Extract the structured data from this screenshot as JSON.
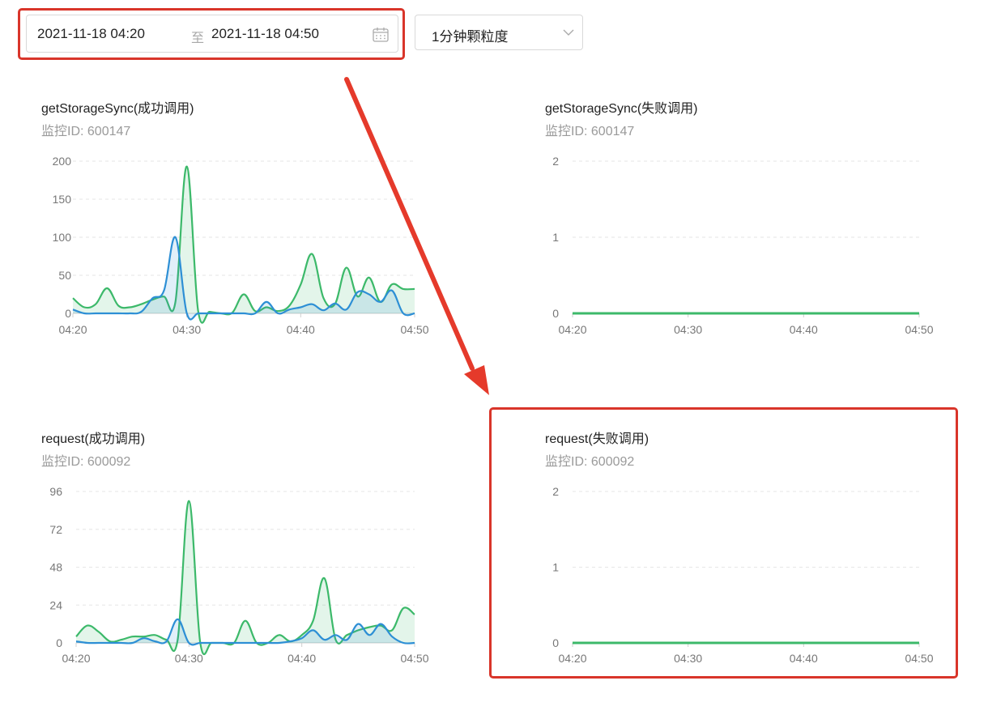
{
  "toolbar": {
    "start": "2021-11-18 04:20",
    "separator": "至",
    "end": "2021-11-18 04:50",
    "granularity": "1分钟颗粒度"
  },
  "colors": {
    "green": "#3cb96a",
    "blue": "#2d8fd5",
    "highlight": "#d9352a"
  },
  "chart_data": [
    {
      "type": "area",
      "title": "getStorageSync(成功调用)",
      "subtitle": "监控ID: 600147",
      "xlabel": "",
      "ylabel": "",
      "x_ticks": [
        "04:20",
        "04:30",
        "04:40",
        "04:50"
      ],
      "y_ticks": [
        0,
        50,
        100,
        150,
        200
      ],
      "ylim": [
        0,
        200
      ],
      "grid": true,
      "series": [
        {
          "color": "#3cb96a",
          "x": [
            0,
            1,
            2,
            3,
            4,
            5,
            6,
            7,
            8,
            9,
            10,
            11,
            12,
            13,
            14,
            15,
            16,
            17,
            18,
            19,
            20,
            21,
            22,
            23,
            24,
            25,
            26,
            27,
            28,
            29,
            30
          ],
          "values": [
            20,
            8,
            12,
            33,
            10,
            8,
            12,
            18,
            22,
            15,
            193,
            3,
            2,
            0,
            1,
            25,
            3,
            8,
            3,
            10,
            38,
            78,
            20,
            12,
            60,
            22,
            47,
            15,
            38,
            32,
            32
          ]
        },
        {
          "color": "#2d8fd5",
          "x": [
            0,
            1,
            2,
            3,
            4,
            5,
            6,
            7,
            8,
            9,
            10,
            11,
            12,
            13,
            14,
            15,
            16,
            17,
            18,
            19,
            20,
            21,
            22,
            23,
            24,
            25,
            26,
            27,
            28,
            29,
            30
          ],
          "values": [
            5,
            0,
            0,
            0,
            0,
            0,
            2,
            20,
            30,
            100,
            0,
            0,
            0,
            0,
            0,
            0,
            0,
            15,
            0,
            5,
            8,
            12,
            4,
            13,
            5,
            28,
            25,
            15,
            30,
            0,
            0
          ]
        }
      ]
    },
    {
      "type": "line",
      "title": "getStorageSync(失败调用)",
      "subtitle": "监控ID: 600147",
      "xlabel": "",
      "ylabel": "",
      "x_ticks": [
        "04:20",
        "04:30",
        "04:40",
        "04:50"
      ],
      "y_ticks": [
        0,
        1,
        2
      ],
      "ylim": [
        0,
        2
      ],
      "grid": true,
      "series": [
        {
          "color": "#3cb96a",
          "x": [
            0,
            30
          ],
          "values": [
            0,
            0
          ]
        }
      ]
    },
    {
      "type": "area",
      "title": "request(成功调用)",
      "subtitle": "监控ID: 600092",
      "xlabel": "",
      "ylabel": "",
      "x_ticks": [
        "04:20",
        "04:30",
        "04:40",
        "04:50"
      ],
      "y_ticks": [
        0,
        24,
        48,
        72,
        96
      ],
      "ylim": [
        0,
        96
      ],
      "grid": true,
      "series": [
        {
          "color": "#3cb96a",
          "x": [
            0,
            1,
            2,
            3,
            4,
            5,
            6,
            7,
            8,
            9,
            10,
            11,
            12,
            13,
            14,
            15,
            16,
            17,
            18,
            19,
            20,
            21,
            22,
            23,
            24,
            25,
            26,
            27,
            28,
            29,
            30
          ],
          "values": [
            4,
            11,
            7,
            1,
            2,
            4,
            4,
            5,
            2,
            2,
            90,
            0,
            0,
            0,
            0,
            14,
            0,
            0,
            5,
            1,
            5,
            14,
            41,
            2,
            5,
            8,
            10,
            11,
            8,
            22,
            18
          ]
        },
        {
          "color": "#2d8fd5",
          "x": [
            0,
            1,
            2,
            3,
            4,
            5,
            6,
            7,
            8,
            9,
            10,
            11,
            12,
            13,
            14,
            15,
            16,
            17,
            18,
            19,
            20,
            21,
            22,
            23,
            24,
            25,
            26,
            27,
            28,
            29,
            30
          ],
          "values": [
            1,
            0,
            0,
            0,
            0,
            0,
            3,
            1,
            1,
            15,
            0,
            0,
            0,
            0,
            0,
            0,
            0,
            0,
            0,
            1,
            3,
            8,
            2,
            5,
            2,
            12,
            5,
            12,
            4,
            0,
            0
          ]
        }
      ]
    },
    {
      "type": "line",
      "title": "request(失败调用)",
      "subtitle": "监控ID: 600092",
      "xlabel": "",
      "ylabel": "",
      "x_ticks": [
        "04:20",
        "04:30",
        "04:40",
        "04:50"
      ],
      "y_ticks": [
        0,
        1,
        2
      ],
      "ylim": [
        0,
        2
      ],
      "grid": true,
      "series": [
        {
          "color": "#3cb96a",
          "x": [
            0,
            30
          ],
          "values": [
            0,
            0
          ]
        }
      ]
    }
  ]
}
